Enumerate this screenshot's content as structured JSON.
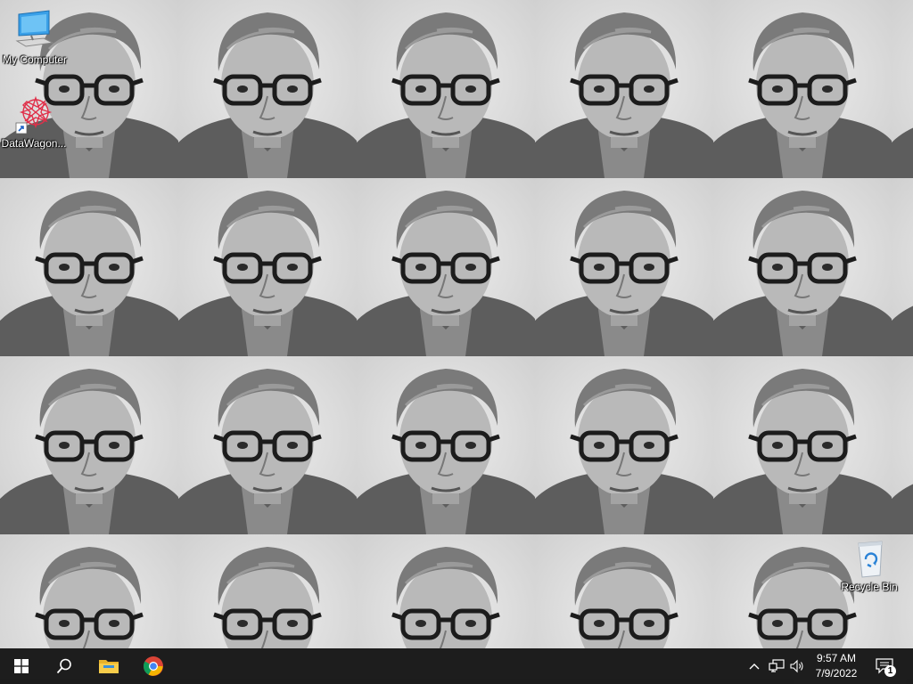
{
  "desktop": {
    "wallpaper": {
      "description_tile": "portrait",
      "rows": 4,
      "cols": 6
    },
    "icons": [
      {
        "label": "My Computer",
        "icon": "computer-icon"
      },
      {
        "label": "DataWagon...",
        "icon": "datawagon-app-icon"
      },
      {
        "label": "Recycle Bin",
        "icon": "recycle-bin-icon"
      }
    ]
  },
  "taskbar": {
    "start_icon": "windows-start-icon",
    "search_icon": "search-icon",
    "pinned": [
      {
        "name": "File Explorer",
        "icon": "folder-icon"
      },
      {
        "name": "Google Chrome",
        "icon": "chrome-icon"
      }
    ],
    "tray": {
      "chevron_icon": "chevron-up-icon",
      "network_icon": "network-icon",
      "volume_icon": "volume-icon"
    },
    "clock": {
      "time": "9:57 AM",
      "date": "7/9/2022"
    },
    "notifications": {
      "icon": "notification-icon",
      "count": "1"
    },
    "colors": {
      "bar": "#101010",
      "foreground": "#ffffff"
    }
  }
}
